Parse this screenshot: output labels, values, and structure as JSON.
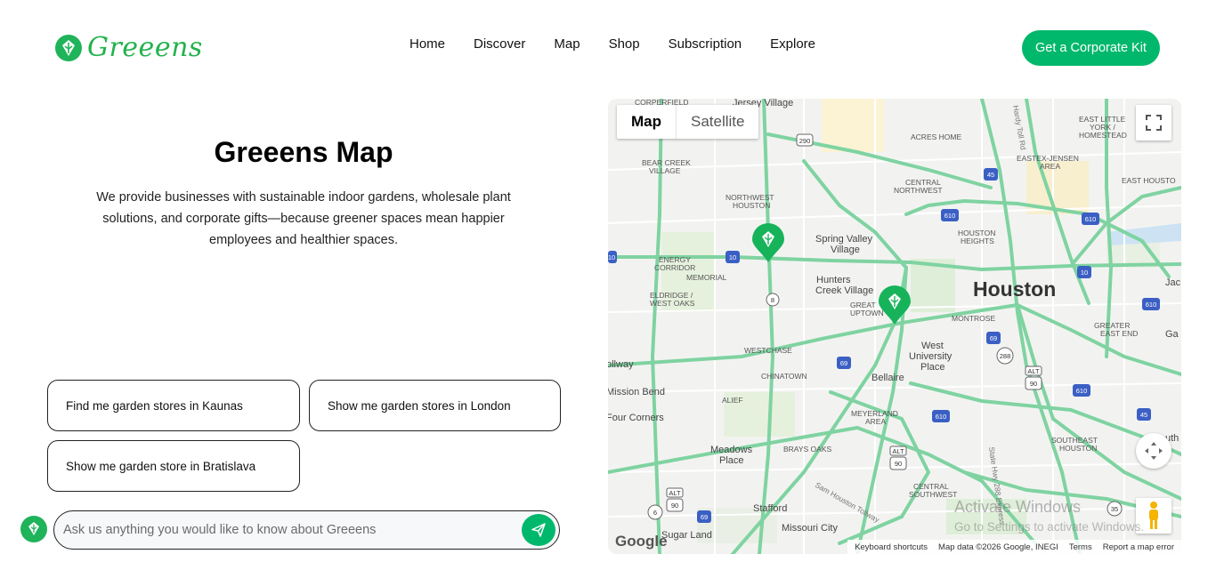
{
  "brand": {
    "name": "Greeens"
  },
  "nav": {
    "items": [
      {
        "label": "Home"
      },
      {
        "label": "Discover"
      },
      {
        "label": "Map"
      },
      {
        "label": "Shop"
      },
      {
        "label": "Subscription"
      },
      {
        "label": "Explore"
      }
    ]
  },
  "header": {
    "cta_label": "Get a Corporate Kit"
  },
  "hero": {
    "title": "Greeens Map",
    "description": "We provide businesses with sustainable indoor gardens, wholesale plant solutions, and corporate gifts—because greener spaces mean happier employees and healthier spaces."
  },
  "suggestions": [
    {
      "label": "Find me garden stores in Kaunas"
    },
    {
      "label": "Show me garden stores in London"
    },
    {
      "label": "Show me garden store in Bratislava"
    }
  ],
  "chat": {
    "placeholder": "Ask us anything you would like to know about Greeens"
  },
  "map": {
    "toggle": {
      "map_label": "Map",
      "satellite_label": "Satellite"
    },
    "city_label": "Houston",
    "place_labels": [
      "CORPERFIELD",
      "Jersey Village",
      "BEAR CREEK",
      "VILLAGE",
      "NORTHWEST",
      "HOUSTON",
      "ACRES HOME",
      "CENTRAL",
      "NORTHWEST",
      "EAST LITTLE",
      "YORK /",
      "HOMESTEAD",
      "EASTEX-JENSEN",
      "AREA",
      "EAST HOUSTO",
      "HOUSTON",
      "HEIGHTS",
      "Spring Valley",
      "Village",
      "ENERGY",
      "CORRIDOR",
      "MEMORIAL",
      "Hunters",
      "Creek Village",
      "ELDRIDGE /",
      "WEST OAKS",
      "GREAT",
      "UPTOWN",
      "MONTROSE",
      "GREATER",
      "EAST END",
      "Jac",
      "WESTCHASE",
      "West",
      "University",
      "Place",
      "CHINATOWN",
      "Bellaire",
      "Mission Bend",
      "ALIEF",
      "Four Corners",
      "MEYERLAND",
      "AREA",
      "SOUTHEAST",
      "HOUSTON",
      "Meadows",
      "Place",
      "BRAYS OAKS",
      "CENTRAL",
      "SOUTHWEST",
      "Stafford",
      "Missouri City",
      "Sugar Land",
      "ollway",
      "Ga",
      "uth"
    ],
    "shields": [
      "290",
      "45",
      "610",
      "610",
      "10",
      "10",
      "8",
      "69",
      "10",
      "610",
      "69",
      "288",
      "610",
      "ALT",
      "90",
      "610",
      "45",
      "ALT",
      "90",
      "6",
      "ALT",
      "90",
      "69",
      "35"
    ],
    "road_labels": [
      "Hardy Toll Rd",
      "Sam Houston Tollway",
      "State Hwy 288 Express"
    ],
    "google_label": "Google",
    "attribution": {
      "shortcuts": "Keyboard shortcuts",
      "map_data": "Map data ©2026 Google, INEGI",
      "terms": "Terms",
      "report": "Report a map error"
    },
    "watermark_title": "Activate Windows",
    "watermark_sub": "Go to Settings to activate Windows."
  },
  "colors": {
    "brand_green": "#00b86b",
    "road": "#7fd3a1",
    "map_bg": "#f2f3f1"
  }
}
